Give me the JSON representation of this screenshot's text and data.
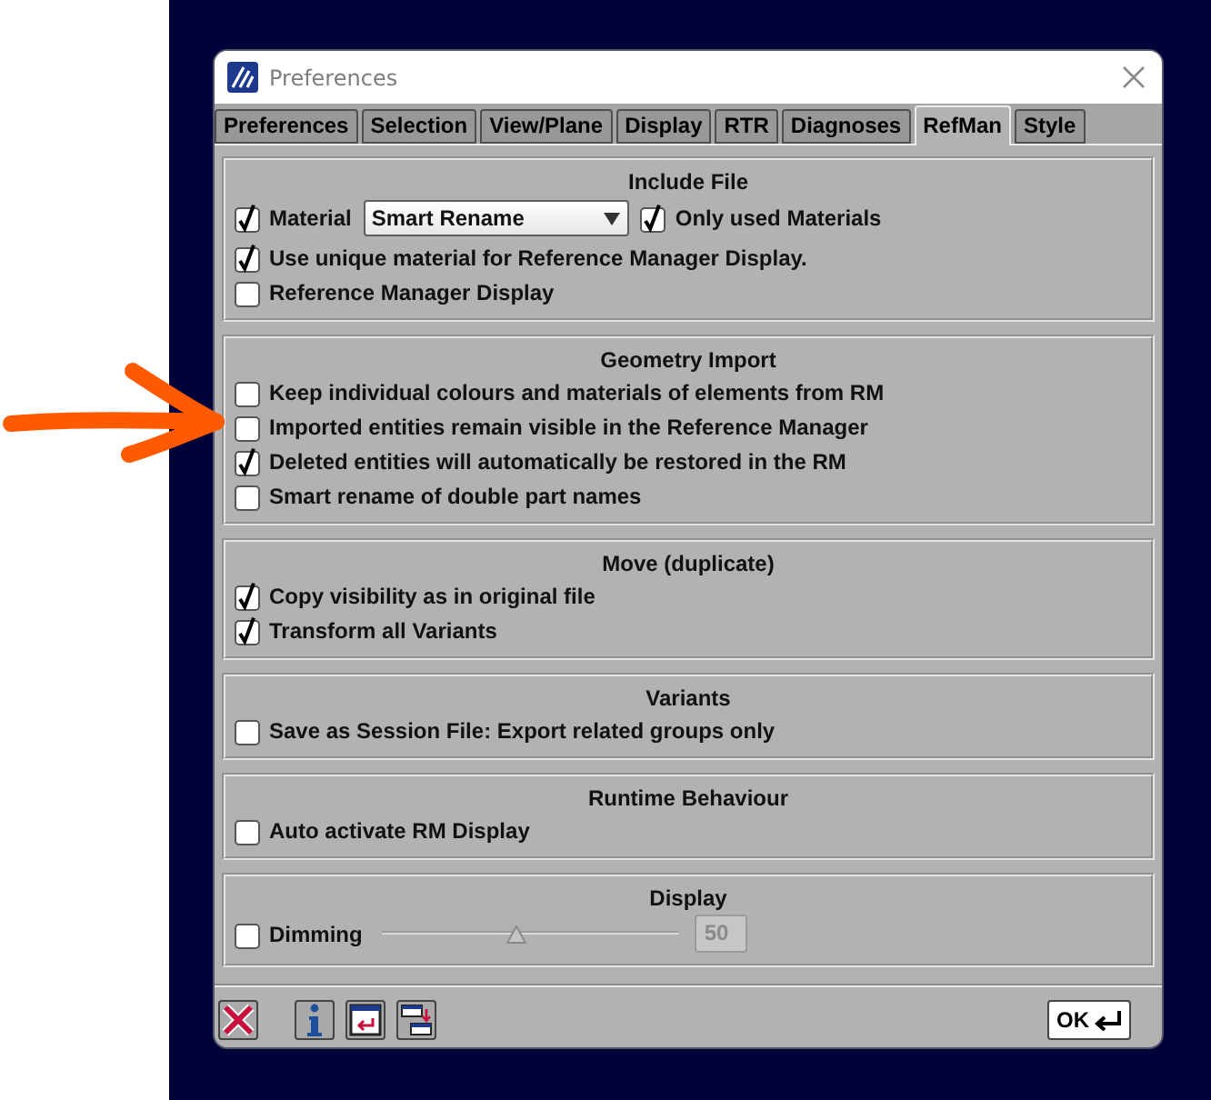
{
  "window": {
    "title": "Preferences"
  },
  "tabs": [
    {
      "label": "Preferences",
      "selected": false
    },
    {
      "label": "Selection",
      "selected": false
    },
    {
      "label": "View/Plane",
      "selected": false
    },
    {
      "label": "Display",
      "selected": false
    },
    {
      "label": "RTR",
      "selected": false
    },
    {
      "label": "Diagnoses",
      "selected": false
    },
    {
      "label": "RefMan",
      "selected": true
    },
    {
      "label": "Style",
      "selected": false
    }
  ],
  "groups": [
    {
      "title": "Include File",
      "rows": [
        {
          "kind": "material",
          "label": "Material",
          "checked": true,
          "dropdown": {
            "value": "Smart Rename"
          },
          "extra": {
            "label": "Only used Materials",
            "checked": true
          }
        },
        {
          "kind": "checkbox",
          "label": "Use unique material for Reference Manager Display.",
          "checked": true
        },
        {
          "kind": "checkbox",
          "label": "Reference Manager Display",
          "checked": false
        }
      ]
    },
    {
      "title": "Geometry Import",
      "rows": [
        {
          "kind": "checkbox",
          "label": "Keep individual colours and materials of elements from RM",
          "checked": false
        },
        {
          "kind": "checkbox",
          "label": "Imported entities remain visible in the Reference Manager",
          "checked": false
        },
        {
          "kind": "checkbox",
          "label": "Deleted entities will automatically be restored in the RM",
          "checked": true
        },
        {
          "kind": "checkbox",
          "label": "Smart rename of double part names",
          "checked": false
        }
      ]
    },
    {
      "title": "Move (duplicate)",
      "rows": [
        {
          "kind": "checkbox",
          "label": "Copy visibility as in original file",
          "checked": true
        },
        {
          "kind": "checkbox",
          "label": "Transform all Variants",
          "checked": true
        }
      ]
    },
    {
      "title": "Variants",
      "rows": [
        {
          "kind": "checkbox",
          "label": "Save as Session File: Export related groups only",
          "checked": false
        }
      ]
    },
    {
      "title": "Runtime Behaviour",
      "rows": [
        {
          "kind": "checkbox",
          "label": "Auto activate RM Display",
          "checked": false
        }
      ]
    },
    {
      "title": "Display",
      "rows": [
        {
          "kind": "slider",
          "label": "Dimming",
          "checked": false,
          "slider": {
            "level": 0.45,
            "disabled": true
          },
          "field": {
            "value": "50",
            "disabled": true
          }
        }
      ]
    }
  ],
  "footer": {
    "ok_button": {
      "label": "OK"
    }
  }
}
